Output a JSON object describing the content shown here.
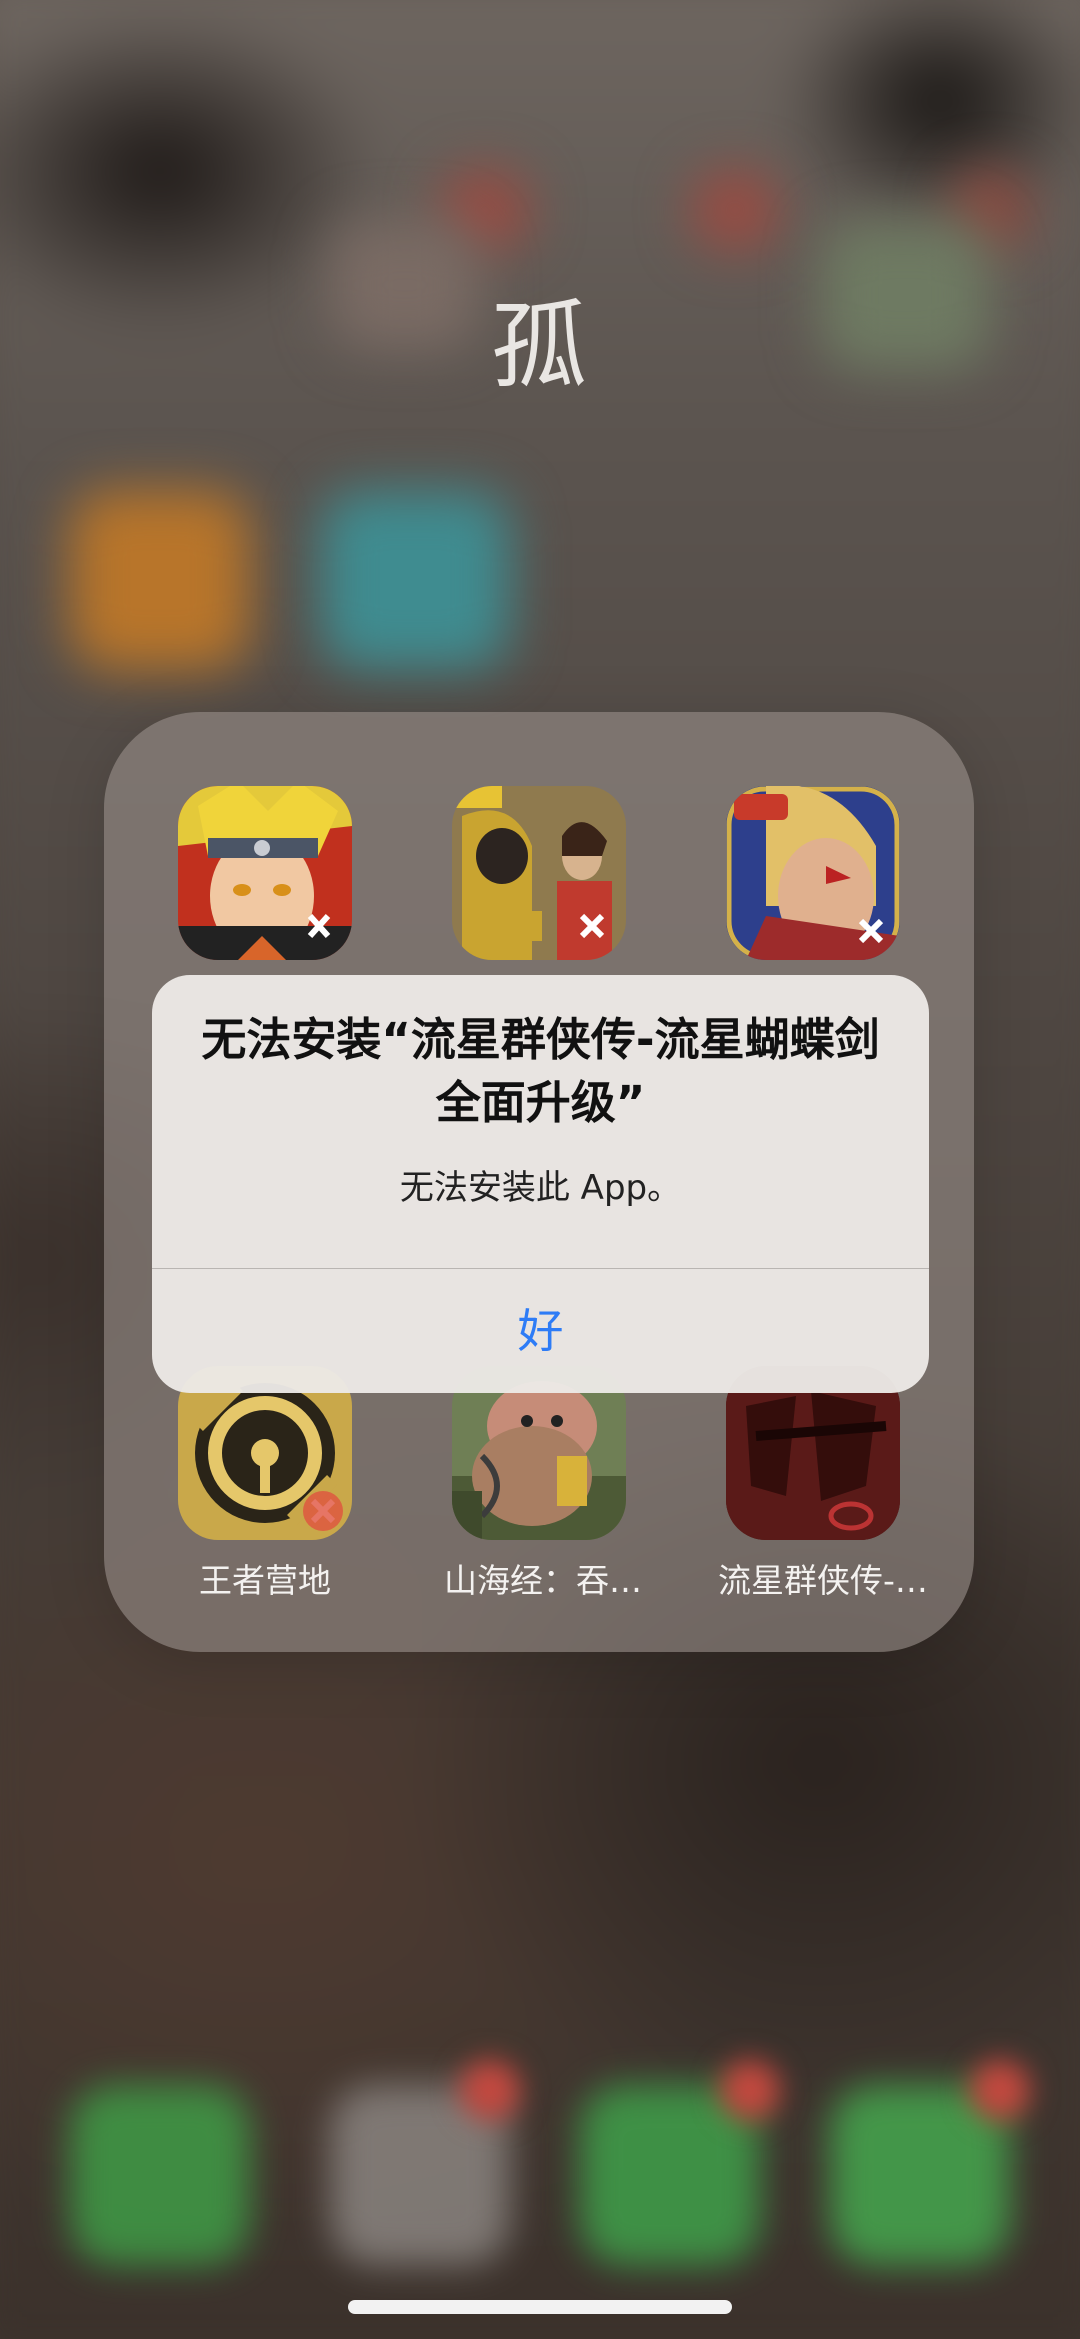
{
  "folder": {
    "title": "孤",
    "apps": [
      {
        "label": "",
        "icon": "naruto-game-icon",
        "row": 1
      },
      {
        "label": "",
        "icon": "peacekeeper-elite-game-icon",
        "row": 1
      },
      {
        "label": "",
        "icon": "honor-of-kings-game-icon",
        "row": 1
      },
      {
        "label": "王者营地",
        "icon": "king-camp-app-icon",
        "row": 2
      },
      {
        "label": "山海经：吞…",
        "icon": "shanhaijing-game-icon",
        "row": 2
      },
      {
        "label": "流星群侠传-…",
        "icon": "meteor-game-icon",
        "row": 2
      }
    ]
  },
  "alert": {
    "title": "无法安装“流星群侠传-流星蝴蝶剑全面升级”",
    "message": "无法安装此 App。",
    "ok_label": "好"
  },
  "dock": {
    "icons": [
      "phone-icon",
      "game-icon",
      "messages-icon",
      "wechat-icon"
    ]
  },
  "colors": {
    "accent": "#2e7cf6",
    "folder_bg": "#968c87",
    "alert_bg": "#ece9e6"
  }
}
